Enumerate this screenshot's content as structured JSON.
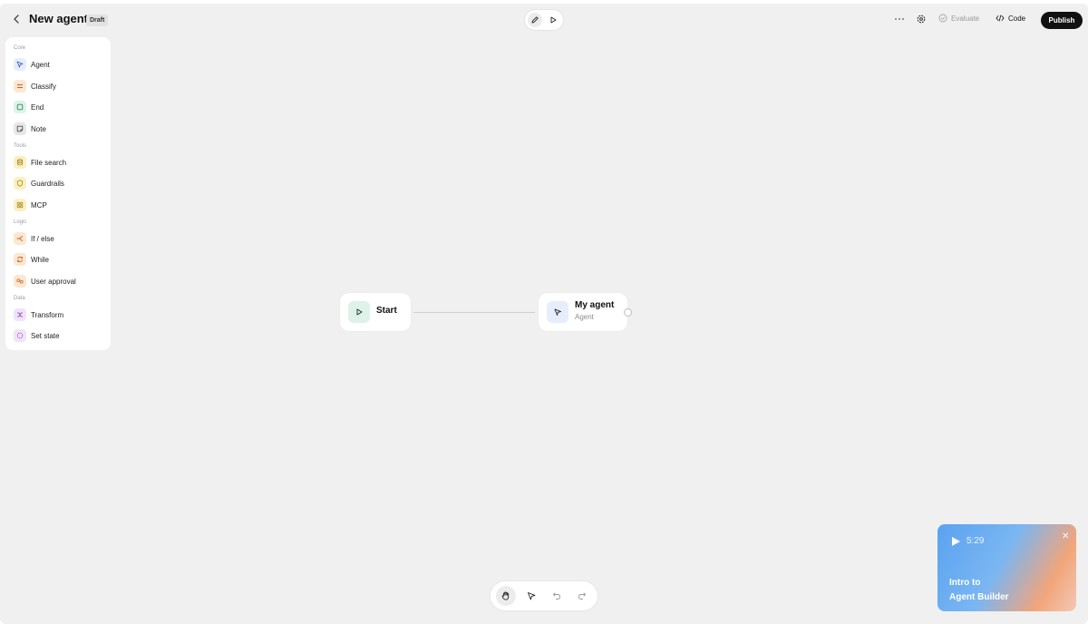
{
  "header": {
    "title": "New agent",
    "badge": "Draft",
    "evaluate_label": "Evaluate",
    "code_label": "Code",
    "publish_label": "Publish"
  },
  "sidebar": {
    "sections": {
      "core": "Core",
      "tools": "Tools",
      "logic": "Logic",
      "data": "Data"
    },
    "items": {
      "agent": "Agent",
      "classify": "Classify",
      "end": "End",
      "note": "Note",
      "file_search": "File search",
      "guardrails": "Guardrails",
      "mcp": "MCP",
      "if_else": "If / else",
      "while": "While",
      "user_approval": "User approval",
      "transform": "Transform",
      "set_state": "Set state"
    }
  },
  "canvas": {
    "start_node": {
      "label": "Start"
    },
    "agent_node": {
      "title": "My agent",
      "subtitle": "Agent"
    }
  },
  "video_card": {
    "duration": "5:29",
    "title_line1": "Intro to",
    "title_line2": "Agent Builder"
  },
  "colors": {
    "publish_bg": "#111111",
    "canvas_bg": "#f0f0f0"
  }
}
